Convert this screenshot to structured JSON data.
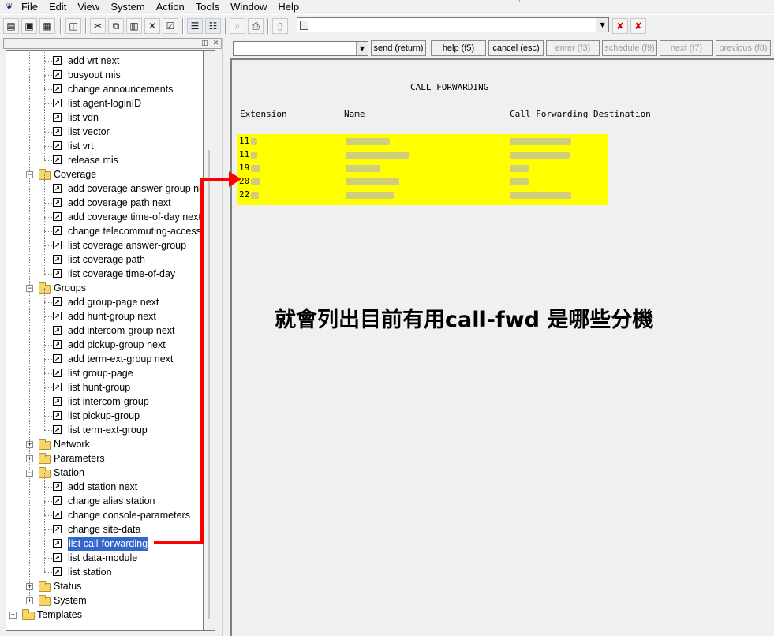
{
  "menu": [
    "File",
    "Edit",
    "View",
    "System",
    "Action",
    "Tools",
    "Window",
    "Help"
  ],
  "tree": {
    "items": [
      {
        "label": "add vrt next",
        "type": "cmd",
        "level": 2
      },
      {
        "label": "busyout mis",
        "type": "cmd",
        "level": 2
      },
      {
        "label": "change announcements",
        "type": "cmd",
        "level": 2
      },
      {
        "label": "list agent-loginID",
        "type": "cmd",
        "level": 2
      },
      {
        "label": "list vdn",
        "type": "cmd",
        "level": 2
      },
      {
        "label": "list vector",
        "type": "cmd",
        "level": 2
      },
      {
        "label": "list vrt",
        "type": "cmd",
        "level": 2
      },
      {
        "label": "release mis",
        "type": "cmd",
        "level": 2
      },
      {
        "label": "Coverage",
        "type": "folder",
        "level": 1,
        "toggle": "−"
      },
      {
        "label": "add coverage answer-group next",
        "type": "cmd",
        "level": 2
      },
      {
        "label": "add coverage path next",
        "type": "cmd",
        "level": 2
      },
      {
        "label": "add coverage time-of-day next",
        "type": "cmd",
        "level": 2
      },
      {
        "label": "change telecommuting-access",
        "type": "cmd",
        "level": 2
      },
      {
        "label": "list coverage answer-group",
        "type": "cmd",
        "level": 2
      },
      {
        "label": "list coverage path",
        "type": "cmd",
        "level": 2
      },
      {
        "label": "list coverage time-of-day",
        "type": "cmd",
        "level": 2
      },
      {
        "label": "Groups",
        "type": "folder",
        "level": 1,
        "toggle": "−"
      },
      {
        "label": "add group-page next",
        "type": "cmd",
        "level": 2
      },
      {
        "label": "add hunt-group next",
        "type": "cmd",
        "level": 2
      },
      {
        "label": "add intercom-group next",
        "type": "cmd",
        "level": 2
      },
      {
        "label": "add pickup-group next",
        "type": "cmd",
        "level": 2
      },
      {
        "label": "add term-ext-group next",
        "type": "cmd",
        "level": 2
      },
      {
        "label": "list group-page",
        "type": "cmd",
        "level": 2
      },
      {
        "label": "list hunt-group",
        "type": "cmd",
        "level": 2
      },
      {
        "label": "list intercom-group",
        "type": "cmd",
        "level": 2
      },
      {
        "label": "list pickup-group",
        "type": "cmd",
        "level": 2
      },
      {
        "label": "list term-ext-group",
        "type": "cmd",
        "level": 2
      },
      {
        "label": "Network",
        "type": "folder",
        "level": 1,
        "toggle": "+"
      },
      {
        "label": "Parameters",
        "type": "folder",
        "level": 1,
        "toggle": "+"
      },
      {
        "label": "Station",
        "type": "folder",
        "level": 1,
        "toggle": "−"
      },
      {
        "label": "add station next",
        "type": "cmd",
        "level": 2
      },
      {
        "label": "change alias station",
        "type": "cmd",
        "level": 2
      },
      {
        "label": "change console-parameters",
        "type": "cmd",
        "level": 2
      },
      {
        "label": "change site-data",
        "type": "cmd",
        "level": 2
      },
      {
        "label": "list call-forwarding",
        "type": "cmd",
        "level": 2,
        "selected": true
      },
      {
        "label": "list data-module",
        "type": "cmd",
        "level": 2
      },
      {
        "label": "list station",
        "type": "cmd",
        "level": 2
      },
      {
        "label": "Status",
        "type": "folder",
        "level": 1,
        "toggle": "+"
      },
      {
        "label": "System",
        "type": "folder",
        "level": 1,
        "toggle": "+"
      },
      {
        "label": "Templates",
        "type": "folder",
        "level": 0,
        "toggle": "+"
      }
    ]
  },
  "buttons": {
    "send": "send (return)",
    "help": "help (f5)",
    "cancel": "cancel (esc)",
    "enter": "enter (f3)",
    "schedule": "schedule (f9)",
    "next": "next (f7)",
    "previous": "previous (f8)"
  },
  "screen": {
    "title": "CALL FORWARDING",
    "col_extension": "Extension",
    "col_name": "Name",
    "col_destination": "Call Forwarding Destination",
    "rows": [
      {
        "extension": "11"
      },
      {
        "extension": "11"
      },
      {
        "extension": "19"
      },
      {
        "extension": "20"
      },
      {
        "extension": "22"
      }
    ]
  },
  "annotation": "就會列出目前有用call-fwd 是哪些分機",
  "colors": {
    "highlight": "#ffff00",
    "arrow": "#ff0000",
    "selection": "#3366cc"
  }
}
